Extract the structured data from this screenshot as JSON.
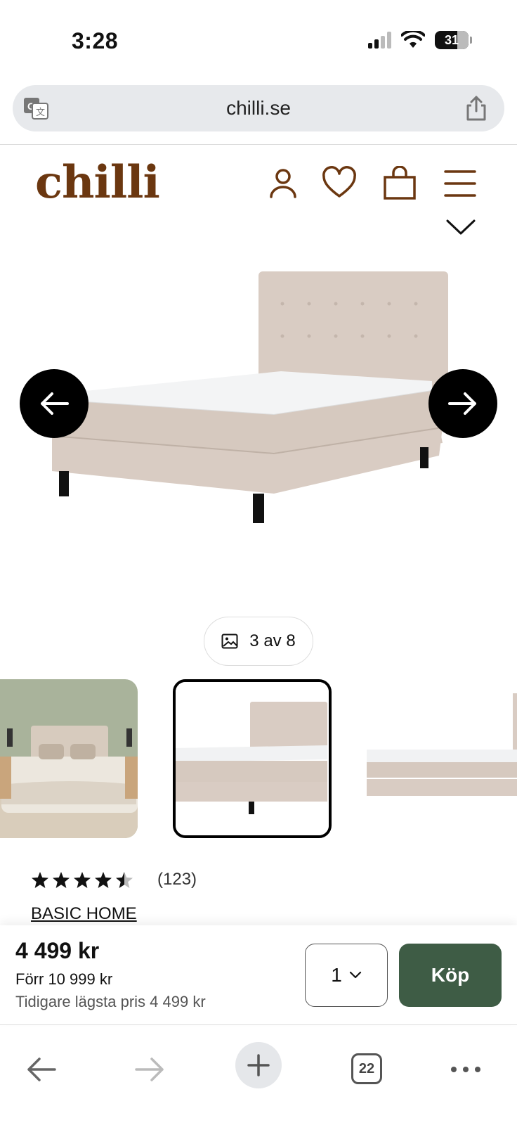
{
  "status_bar": {
    "time": "3:28",
    "battery": "31"
  },
  "browser": {
    "url": "chilli.se",
    "tab_count": "22"
  },
  "site": {
    "logo": "chilli"
  },
  "gallery": {
    "counter": "3 av 8"
  },
  "product": {
    "rating": 4.5,
    "review_count": "(123)",
    "brand": "BASIC HOME"
  },
  "buy_bar": {
    "price": "4 499 kr",
    "before_price": "Förr 10 999 kr",
    "lowest_price": "Tidigare lägsta pris 4 499 kr",
    "quantity": "1",
    "buy_label": "Köp"
  },
  "colors": {
    "brand": "#6b3710",
    "buy_button": "#3e5c45",
    "bed_fabric": "#d9ccc3"
  }
}
